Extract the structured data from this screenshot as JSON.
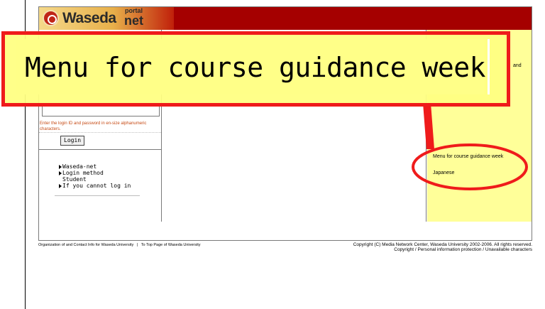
{
  "header": {
    "logo_main": "Waseda",
    "logo_portal": "portal",
    "logo_net": "net"
  },
  "login": {
    "hint": "Enter the login ID and password in en-size alphanumeric characters.",
    "button_label": "Login"
  },
  "links": [
    {
      "label": "Waseda-net",
      "arrow": true
    },
    {
      "label": "Login method",
      "arrow": true
    },
    {
      "label": "Student",
      "arrow": false
    },
    {
      "label": "If you cannot log in",
      "arrow": true
    }
  ],
  "right_panel": {
    "partial_text": "and",
    "menu_link": "Menu for course guidance week",
    "language_link": "Japanese"
  },
  "footer": {
    "org_link": "Organization of and Contact Info for Waseda University",
    "separator": "|",
    "top_page_link": "To Top Page of Waseda University",
    "copyright": "Copyright (C) Media Network Center, Waseda University 2002-2006. All rights reserved.",
    "footer_links": "Copyright / Personal information protection / Unavailable characters"
  },
  "callout": {
    "text": "Menu for course guidance week"
  },
  "colors": {
    "header": "#a50000",
    "right_panel": "#ffff99",
    "highlight": "#ef1b1b",
    "hint_text": "#c64a14"
  }
}
